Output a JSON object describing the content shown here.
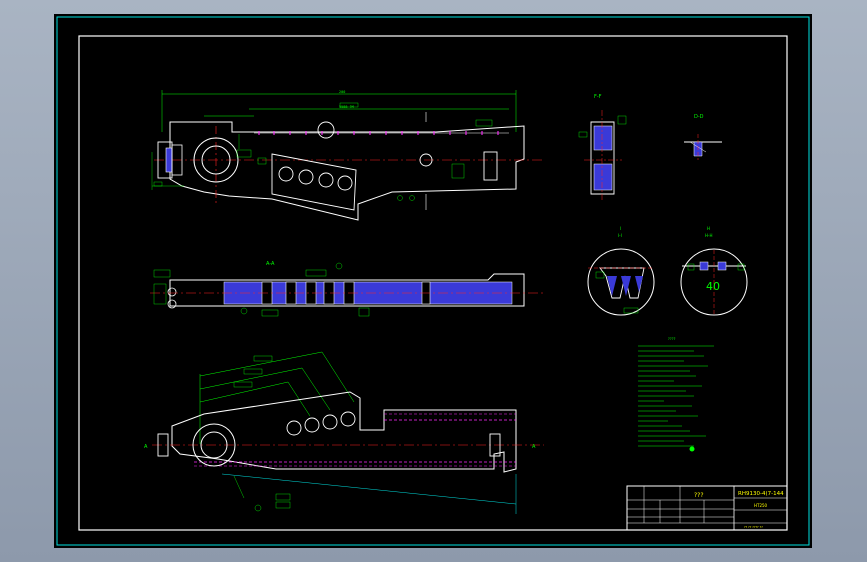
{
  "title_block": {
    "drawing_title": "???",
    "drawing_number": "RH9130-4(7-144",
    "material_code": "HT250",
    "sub_text": "?? ?? ???? ??"
  },
  "labels": {
    "section_ff": "F-F",
    "section_dd": "D-D",
    "section_aa": "A-A",
    "section_ii": "I′\nI-I",
    "section_hh": "H′\nH-I",
    "dim_40": "40",
    "side_a_left": "A",
    "side_a_right": "A",
    "notes_heading": "????"
  },
  "colors": {
    "background_gradient_top": "#a9b4c3",
    "sheet": "#000000",
    "border": "#ffffff",
    "frame": "#00e0e0",
    "part_outline": "#ffffff",
    "centerline": "#ff2020",
    "dimensions": "#00ff00",
    "hatching": "#3a3ad8",
    "hidden": "#ff2aff",
    "title_block_text": "#ffff00"
  }
}
